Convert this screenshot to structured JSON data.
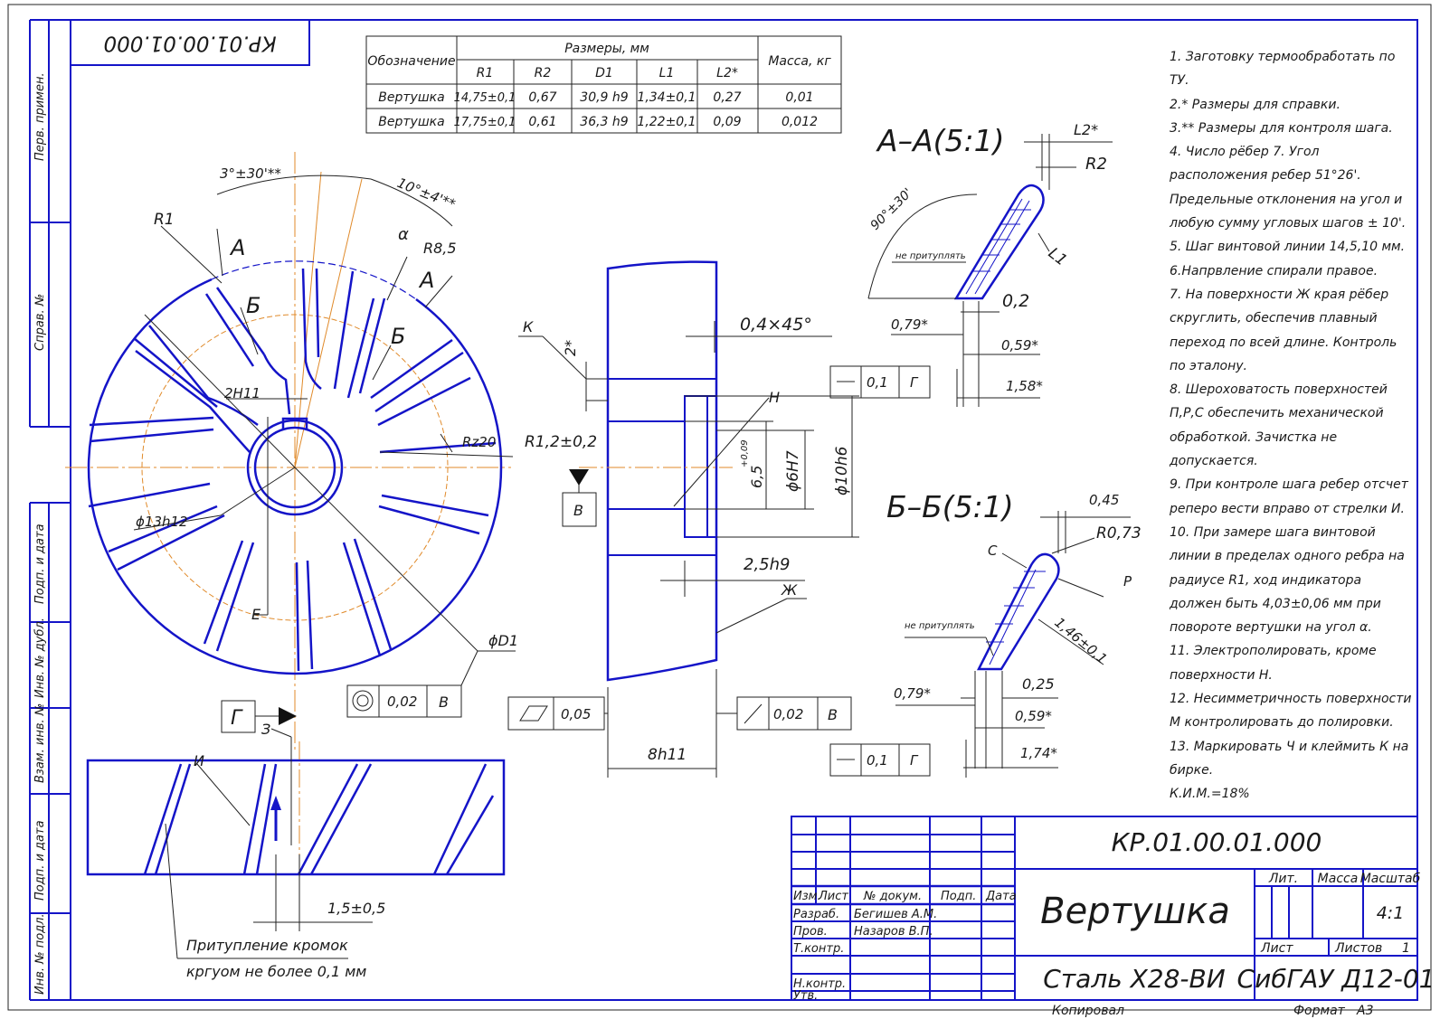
{
  "doc_code_rotated": "КР.01.00.01.000",
  "side_stamp": {
    "perv_primen": "Перв. примен.",
    "sprav_no": "Справ. №",
    "podp_data_1": "Подп. и дата",
    "inv_dubl": "Инв. № дубл.",
    "vzam_inv": "Взам. инв. №",
    "podp_data_2": "Подп. и дата",
    "inv_podl": "Инв. № подл."
  },
  "table": {
    "h_designation": "Обозначение",
    "h_sizes": "Размеры, мм",
    "h_mass": "Масса, кг",
    "cols": [
      "R1",
      "R2",
      "D1",
      "L1",
      "L2*"
    ],
    "rows": [
      {
        "name": "Вертушка",
        "vals": [
          "14,75±0,1",
          "0,67",
          "30,9 h9",
          "1,34±0,1",
          "0,27"
        ],
        "mass": "0,01"
      },
      {
        "name": "Вертушка",
        "vals": [
          "17,75±0,1",
          "0,61",
          "36,3 h9",
          "1,22±0,1",
          "0,09"
        ],
        "mass": "0,012"
      }
    ]
  },
  "notes": [
    "1. Заготовку термообработать по ТУ.",
    "2.* Размеры для справки.",
    "3.** Размеры для контроля шага.",
    "4. Число рёбер 7. Угол расположения ребер 51°26'. Предельные отклонения на угол и любую сумму угловых шагов ± 10'.",
    "5. Шаг винтовой линии 14,5,10 мм.",
    "6.Напрвление спирали правое.",
    "7. На поверхности Ж края рёбер скруглить, обеспечив плавный переход по всей длине. Контроль по эталону.",
    "8. Шероховатость поверхностей П,Р,С обеспечить механической обработкой. Зачистка не допускается.",
    "9. При контроле шага ребер отсчет реперо вести вправо от стрелки И.",
    "10. При замере шага винтовой линии в пределах одного ребра на радиусе R1, ход индикатора должен быть 4,03±0,06 мм при повороте вертушки на угол α.",
    "11. Электрополировать, кроме поверхности Н.",
    "12. Несимметричность поверхности М контролировать до полировки.",
    "13. Маркировать Ч и клеймить К на бирке.",
    "К.И.М.=18%"
  ],
  "front_view": {
    "ang1": "3°±30'**",
    "ang2": "10°±4'**",
    "r1": "R1",
    "a1": "А",
    "a2": "А",
    "b1": "Б",
    "b2": "Б",
    "alpha": "α",
    "r85": "R8,5",
    "h11": "2H11",
    "rz": "Rz20",
    "d13": "ϕ13h12",
    "e": "Е",
    "d1": "ϕD1",
    "conc_tol": "0,02",
    "conc_base": "В"
  },
  "side_view": {
    "k": "К",
    "two": "2*",
    "chamfer": "0,4×45°",
    "h": "Н",
    "r12": "R1,2±0,2",
    "b": "В",
    "d65": "6,5",
    "d65_tol": "+0,09",
    "d6h7": "ϕ6Н7",
    "d10h6": "ϕ10h6",
    "w25": "2,5h9",
    "zh": "Ж",
    "w8": "8h11",
    "flat_tol": "0,05",
    "runout_tol": "0,02",
    "runout_base": "В"
  },
  "section_aa": {
    "title": "А–А(5:1)",
    "l2": "L2*",
    "r2": "R2",
    "ang": "90°±30'",
    "np": "не притуплять",
    "l1": "L1",
    "d02": "0,2",
    "d079": "0,79*",
    "d059": "0,59*",
    "d158": "1,58*",
    "tol": "0,1",
    "base": "Г"
  },
  "section_bb": {
    "title": "Б–Б(5:1)",
    "d045": "0,45",
    "r073": "R0,73",
    "c": "С",
    "p": "Р",
    "np": "не притуплять",
    "d146": "1,46±0,1",
    "d025": "0,25",
    "d079": "0,79*",
    "d059": "0,59*",
    "d174": "1,74*",
    "tol": "0,1",
    "base": "Г"
  },
  "bottom_view": {
    "g": "Г",
    "z": "З",
    "i": "И",
    "d15": "1,5±0,5",
    "note1": "Притупление кромок",
    "note2": "кргуом не более 0,1 мм"
  },
  "title_block": {
    "code": "КР.01.00.01.000",
    "name": "Вертушка",
    "material": "Сталь Х28-ВИ",
    "org": "СибГАУ Д12-01",
    "lit": "Лит.",
    "massa": "Масса",
    "masshtab": "Масштаб",
    "scale": "4:1",
    "list": "Лист",
    "listov": "Листов",
    "listov_val": "1",
    "izm": "Изм.",
    "list2": "Лист",
    "doc": "№ докум.",
    "podp": "Подп.",
    "data": "Дата",
    "razrab": "Разраб.",
    "razrab_name": "Бегишев А.М.",
    "prov": "Пров.",
    "prov_name": "Назаров В.П.",
    "tkontr": "Т.контр.",
    "nkontr": "Н.контр.",
    "utv": "Утв.",
    "kopiroval": "Копировал",
    "format": "Формат",
    "format_val": "А3"
  }
}
